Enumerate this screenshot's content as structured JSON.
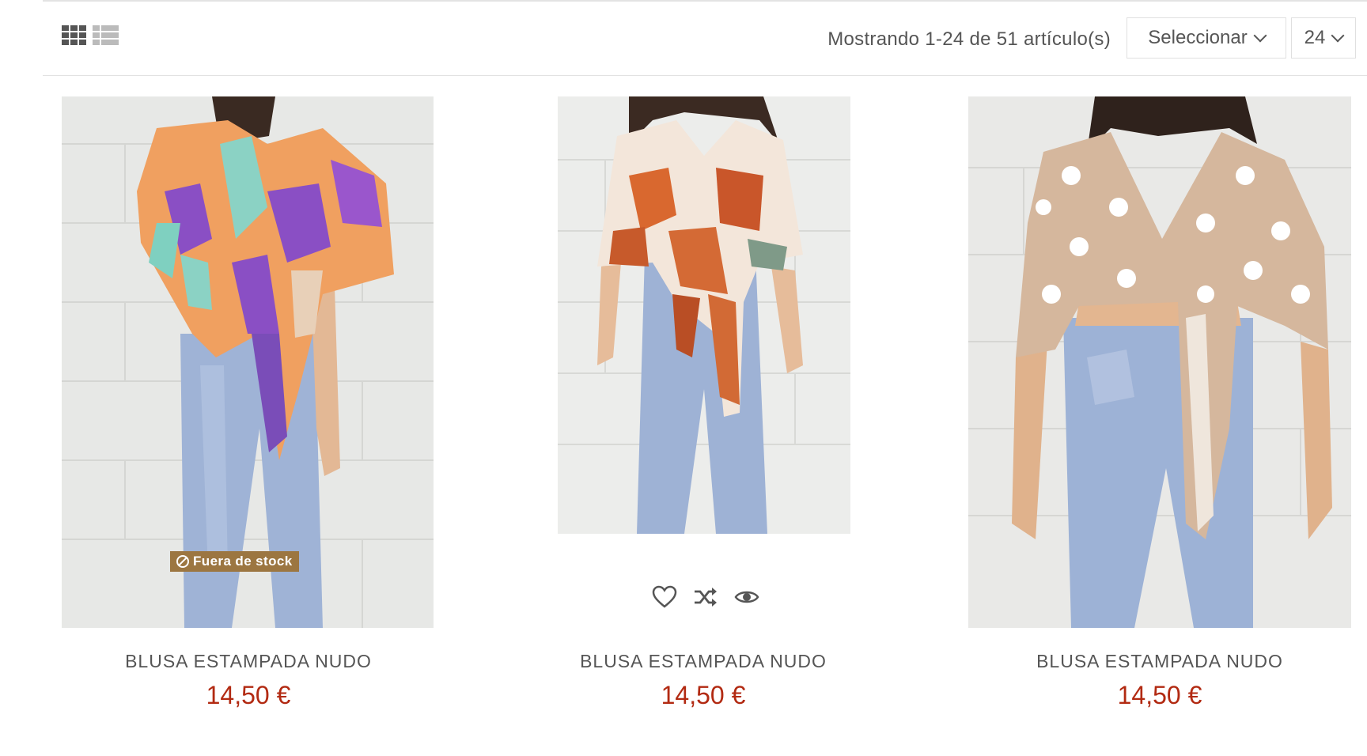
{
  "toolbar": {
    "showing_text": "Mostrando 1-24 de 51 artículo(s)",
    "sort_label": "Seleccionar",
    "per_page_label": "24"
  },
  "products": [
    {
      "name": "BLUSA ESTAMPADA NUDO",
      "price": "14,50 €",
      "badge": "Fuera de stock"
    },
    {
      "name": "BLUSA ESTAMPADA NUDO",
      "price": "14,50 €"
    },
    {
      "name": "BLUSA ESTAMPADA NUDO",
      "price": "14,50 €"
    }
  ],
  "colors": {
    "price": "#b22a12",
    "badge": "#9c7641"
  },
  "icons": [
    "grid-view-icon",
    "list-view-icon",
    "heart-icon",
    "compare-icon",
    "eye-icon",
    "ban-icon",
    "chevron-down-icon"
  ]
}
